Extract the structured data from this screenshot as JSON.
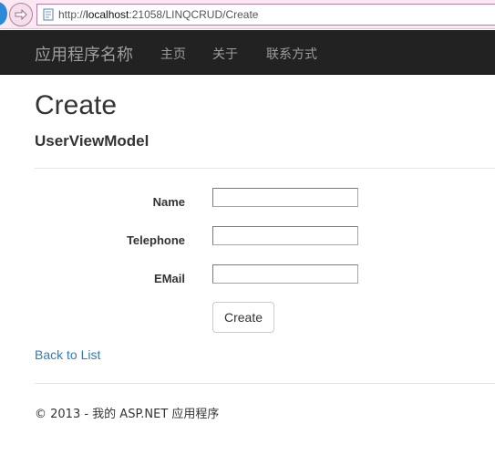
{
  "browser": {
    "url_prefix": "http://",
    "url_host": "localhost",
    "url_rest": ":21058/LINQCRUD/Create"
  },
  "navbar": {
    "brand": "应用程序名称",
    "items": [
      {
        "label": "主页"
      },
      {
        "label": "关于"
      },
      {
        "label": "联系方式"
      }
    ]
  },
  "main": {
    "title": "Create",
    "subtitle": "UserViewModel",
    "fields": [
      {
        "label": "Name",
        "value": ""
      },
      {
        "label": "Telephone",
        "value": ""
      },
      {
        "label": "EMail",
        "value": ""
      }
    ],
    "submit_label": "Create",
    "back_link": "Back to List"
  },
  "footer": {
    "text": "© 2013 - 我的 ASP.NET 应用程序"
  }
}
